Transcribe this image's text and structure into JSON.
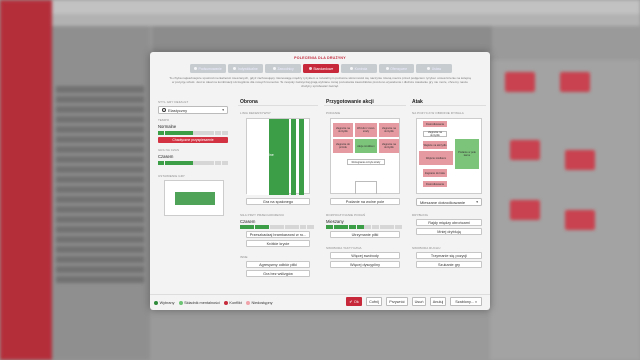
{
  "dialog": {
    "title": "POLECENIA DLA DRUŻYNY",
    "tabs": [
      {
        "label": "Podsumowanie",
        "active": false
      },
      {
        "label": "Indywidualne",
        "active": false
      },
      {
        "label": "Zawodnicy",
        "active": false
      },
      {
        "label": "Standardowe",
        "active": true
      },
      {
        "label": "Kontrola",
        "active": false
      },
      {
        "label": "Ofensywne",
        "active": false
      },
      {
        "label": "Ustaw",
        "active": false
      }
    ],
    "description": "To chyba najważniejsze spośród mentalności mieszanych, gdyż zachowujący równowagę między ryzykiem a rozważnym poziomie skromności się naczynie równą mecze przed podjęciem ryzyka i umieszczenie na kolejną w pozycję sztuki. Jest to ideal na kombinacji szczególnie dla nowych trenerów. Te zespoły zazwyczaj grają wybrane mniej pozostania zawodników proszono wyważenie i dłuższe stawianie gry nie może, chcemy nasze drużyny spróbować zacząć."
  },
  "left": {
    "style_section": "STYL GRY DEFAULT",
    "style_value": "Elastyczny",
    "tempo_section": "TEMPO",
    "tempo_value": "Normalne",
    "tempo_level": 0.5,
    "tempo_button": "Chaotyczne przyspieszenie",
    "time_section": "GRA NA CZAS",
    "time_value": "Czasem",
    "time_level": 0.5,
    "formation_section": "USTAWIENIE GRY"
  },
  "defence": {
    "header": "Obrona",
    "line_section": "LINIA DEFENSYWNY",
    "line_label": "Normalne",
    "line_button": "Gra na spalonego",
    "press_section": "SIŁA PRZY PRZECHODZENIU",
    "press_value": "Czasem",
    "press_level": 0.45,
    "press_button": "Przeszkadzaj bramkarzowi w ro...",
    "press_button2": "Krótkie krycie",
    "other_section": "INNE",
    "other_button1": "Agresywny odbiór piłki",
    "other_button2": "Gra bez wślizgów"
  },
  "build": {
    "header": "Przygotowanie akcji",
    "section": "PODANIE",
    "zones": {
      "z1": "Zagranie na skrzydło",
      "z2": "Wrzutki z zewn. strefy",
      "z3": "Zagranie na skrzydło",
      "z4": "Zagranie do przodu",
      "z5": "Akcje środkiem",
      "z6": "Zagranie na skrzydło",
      "z7": "Rozegranie od tyłu strefy"
    },
    "button": "Podanie na wolne pole",
    "tempo_section": "ROZPOCZYNANIE PODAŃ",
    "tempo_value": "Mieszany",
    "tempo_level": 0.5,
    "tempo_button": "Utrzymanie piłki",
    "freedom_section": "SWOBODA TAKTYCZNA",
    "freedom_button1": "Więcej swobody",
    "freedom_button2": "Więcej dyscypliny"
  },
  "attack": {
    "header": "Atak",
    "section": "NA POZYCJI W OBRONIE RYWALA",
    "zones": {
      "a1": "Dośrodkowania",
      "a2": "Zagranie na skrzydło",
      "a3": "Wejście na skrzydło",
      "a4": "Wejście środkiem",
      "a5": "Podanie w pole karne",
      "a6": "Zagranie do boku",
      "a7": "Dośrodkowania"
    },
    "select_value": "Mieszane dośrodkowanie",
    "dribble_section": "DRYBLING",
    "dribble_button1": "Rajdy między obrońcami",
    "dribble_button2": "Mniej dryblują",
    "creative_section": "SWOBODA RUCHU",
    "creative_button1": "Trzymanie się pozycji",
    "creative_button2": "Szukanie gry"
  },
  "legend": [
    {
      "label": "Wybrany",
      "color": "#2e8b3a"
    },
    {
      "label": "Składnik mentalności",
      "color": "#6cc474"
    },
    {
      "label": "Konflikt",
      "color": "#c62c3c"
    },
    {
      "label": "Niedostępny",
      "color": "#f0a3a9"
    }
  ],
  "footer": {
    "ok": "Ok",
    "undo": "Cofnij",
    "restore": "Przywróć",
    "delete": "Usuń",
    "clear": "Anuluj",
    "templates": "Szablony..."
  },
  "colors": {
    "accent": "#c7283a",
    "green": "#3c9f48",
    "zone_red": "#e49aa0",
    "zone_green": "#7cc47a"
  }
}
